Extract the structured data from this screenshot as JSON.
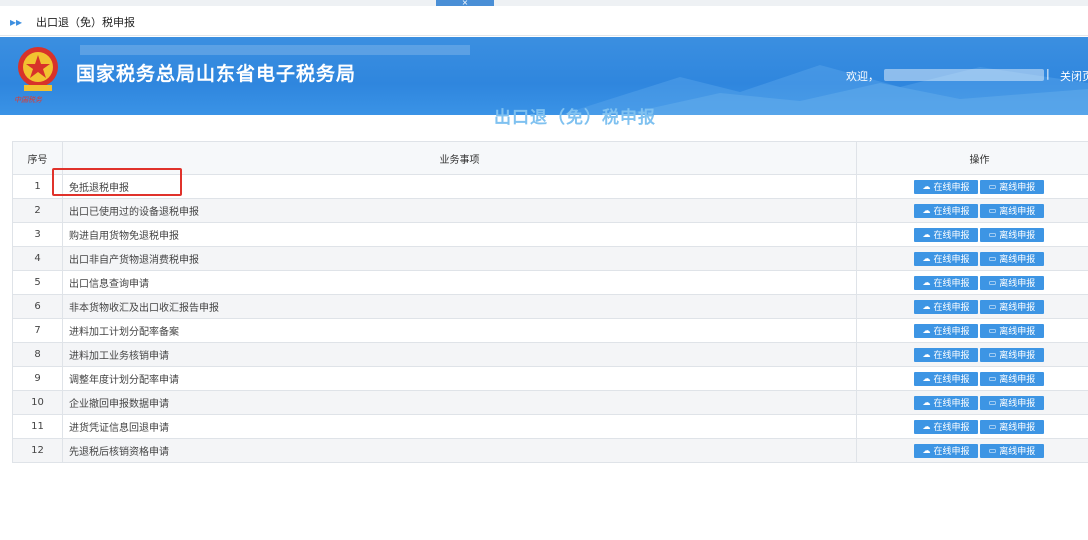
{
  "top_tab": {
    "label": "×"
  },
  "titlebar": {
    "icon": "double-chevron-right-icon",
    "title": "出口退（免）税申报"
  },
  "header": {
    "site_title": "国家税务总局山东省电子税务局",
    "emblem_script": "中国税务",
    "welcome": "欢迎，",
    "separator": "|",
    "close_label": "关闭页",
    "brand_color": "#2f86de"
  },
  "page_heading": "出口退（免）税申报",
  "table": {
    "columns": [
      "序号",
      "业务事项",
      "操作"
    ],
    "online_label": "在线申报",
    "offline_label": "离线申报",
    "online_icon": "cloud-upload-icon",
    "offline_icon": "monitor-icon",
    "rows": [
      {
        "index": "1",
        "item": "免抵退税申报"
      },
      {
        "index": "2",
        "item": "出口已使用过的设备退税申报"
      },
      {
        "index": "3",
        "item": "购进自用货物免退税申报"
      },
      {
        "index": "4",
        "item": "出口非自产货物退消费税申报"
      },
      {
        "index": "5",
        "item": "出口信息查询申请"
      },
      {
        "index": "6",
        "item": "非本货物收汇及出口收汇报告申报"
      },
      {
        "index": "7",
        "item": "进料加工计划分配率备案"
      },
      {
        "index": "8",
        "item": "进料加工业务核销申请"
      },
      {
        "index": "9",
        "item": "调整年度计划分配率申请"
      },
      {
        "index": "10",
        "item": "企业撤回申报数据申请"
      },
      {
        "index": "11",
        "item": "进货凭证信息回退申请"
      },
      {
        "index": "12",
        "item": "先退税后核销资格申请"
      }
    ]
  }
}
